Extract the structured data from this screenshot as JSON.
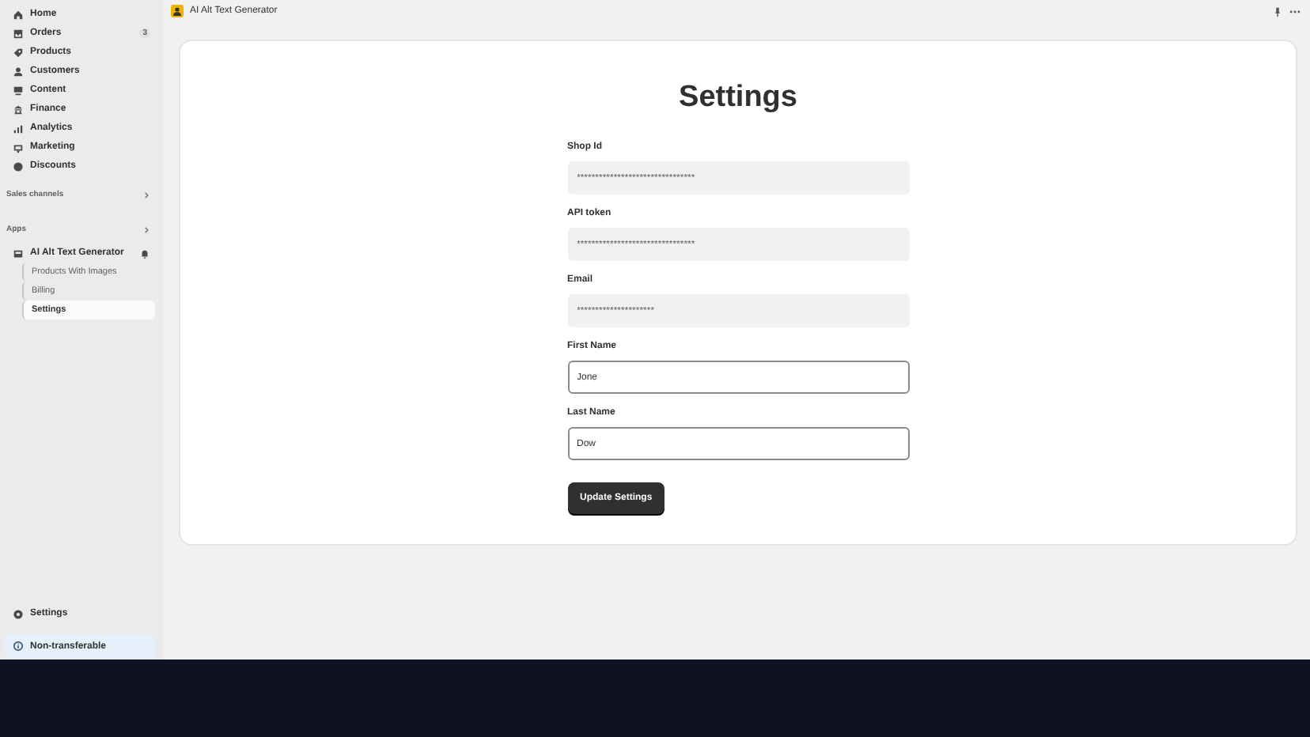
{
  "sidebar": {
    "nav": [
      {
        "label": "Home",
        "selected": false
      },
      {
        "label": "Orders",
        "badge": "3",
        "selected": false
      },
      {
        "label": "Products",
        "selected": false
      },
      {
        "label": "Customers",
        "selected": false
      },
      {
        "label": "Content",
        "selected": false
      },
      {
        "label": "Finance",
        "selected": false
      },
      {
        "label": "Analytics",
        "selected": false
      },
      {
        "label": "Marketing",
        "selected": false
      },
      {
        "label": "Discounts",
        "selected": false
      }
    ],
    "sections": [
      {
        "label": "Sales channels"
      },
      {
        "label": "Apps"
      }
    ],
    "app": {
      "label": "AI Alt Text Generator",
      "children": [
        {
          "label": "Products With Images",
          "selected": false
        },
        {
          "label": "Billing",
          "selected": false
        },
        {
          "label": "Settings",
          "selected": true
        }
      ]
    },
    "footer_item": {
      "label": "Settings"
    },
    "notice": {
      "label": "Non-transferable"
    }
  },
  "topbar": {
    "title": "AI Alt Text Generator"
  },
  "page": {
    "title": "Settings",
    "fields": [
      {
        "label": "Shop Id",
        "value": "********************************",
        "disabled": true
      },
      {
        "label": "API token",
        "value": "********************************",
        "disabled": true
      },
      {
        "label": "Email",
        "value": "*********************",
        "disabled": true
      },
      {
        "label": "First Name",
        "value": "Jone",
        "disabled": false
      },
      {
        "label": "Last Name",
        "value": "Dow",
        "disabled": false
      }
    ],
    "button": "Update Settings"
  }
}
